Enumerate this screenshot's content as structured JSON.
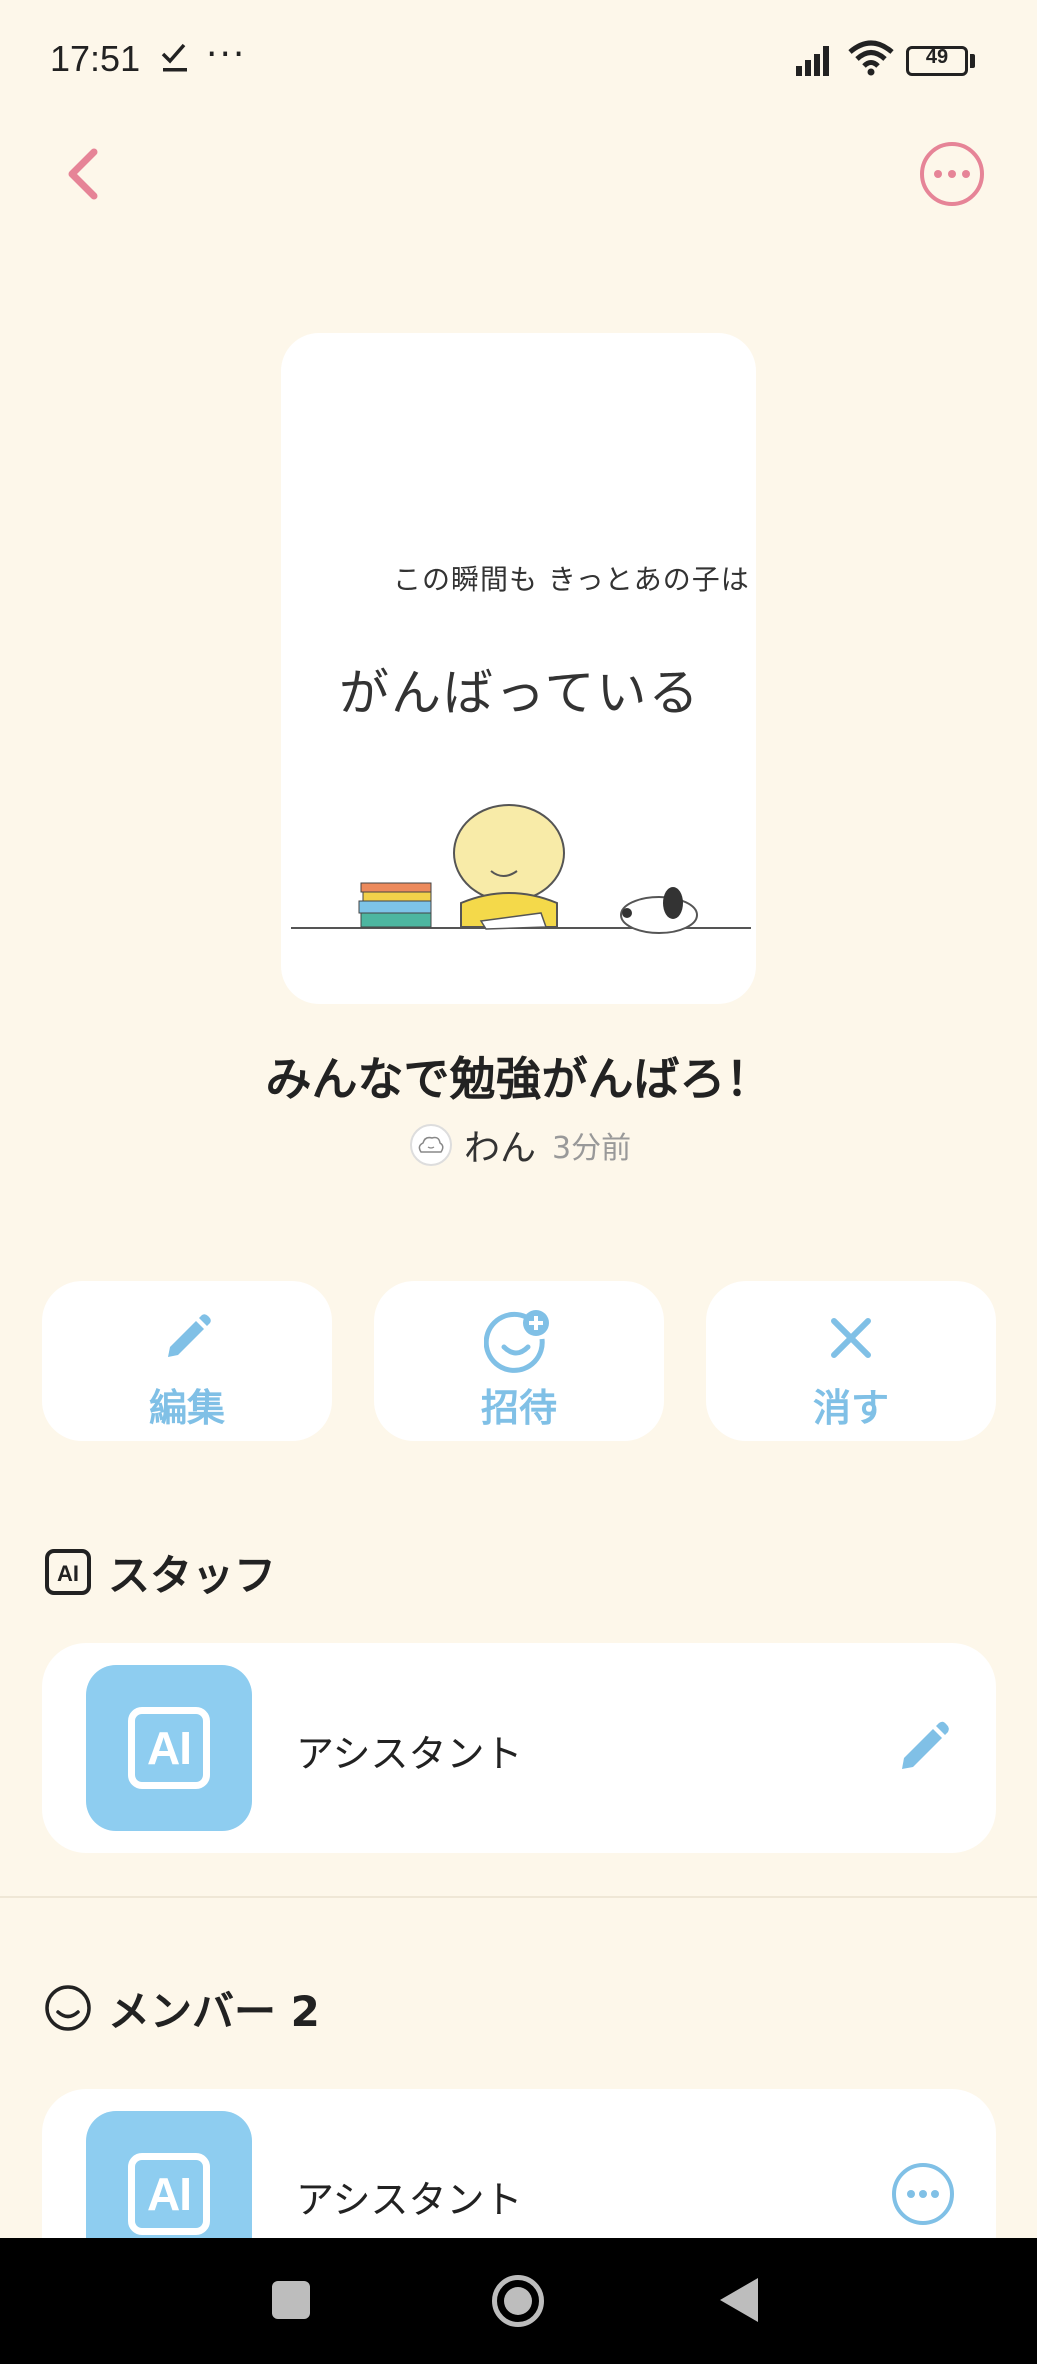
{
  "status_bar": {
    "time": "17:51",
    "more": "···",
    "battery": "49"
  },
  "header": {
    "back_icon": "chevron-left-icon",
    "more_icon": "more-horizontal-icon",
    "accent_color": "#e68497"
  },
  "cover": {
    "line_small": "この瞬間も きっとあの子は",
    "line_big": "がんばっている"
  },
  "group": {
    "title": "みんなで勉強がんばろ！",
    "author": "わん",
    "time": "3分前"
  },
  "actions": [
    {
      "label": "編集",
      "icon": "pencil-icon"
    },
    {
      "label": "招待",
      "icon": "invite-smile-plus-icon"
    },
    {
      "label": "消す",
      "icon": "close-icon"
    }
  ],
  "staff_section": {
    "title": "スタッフ",
    "members": [
      {
        "avatar_text": "AI",
        "name": "アシスタント",
        "action_icon": "pencil-icon"
      }
    ]
  },
  "member_section": {
    "title": "メンバー 2",
    "members": [
      {
        "avatar_text": "AI",
        "name": "アシスタント",
        "action_icon": "more-horizontal-icon"
      }
    ]
  },
  "colors": {
    "background": "#fdf7ea",
    "accent_blue": "#80c0e6",
    "avatar_blue": "#8ecdf0",
    "accent_pink": "#e68497"
  }
}
